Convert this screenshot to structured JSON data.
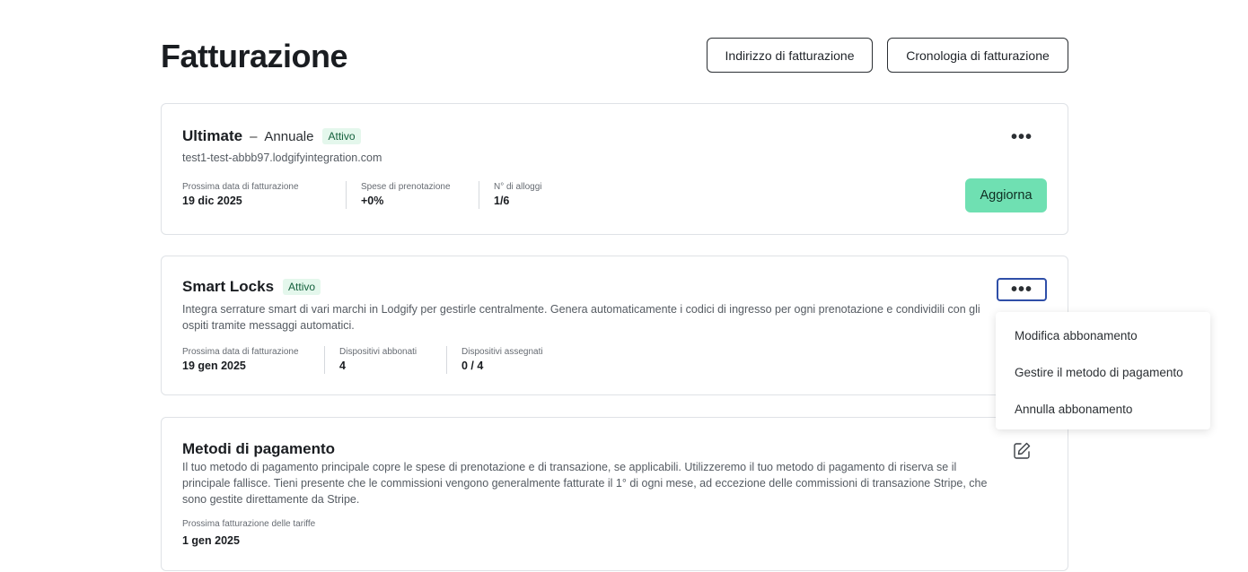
{
  "page": {
    "title": "Fatturazione"
  },
  "header": {
    "billing_address_label": "Indirizzo di fatturazione",
    "billing_history_label": "Cronologia di fatturazione"
  },
  "ultimate_plan": {
    "name": "Ultimate",
    "dash": "–",
    "period": "Annuale",
    "status": "Attivo",
    "domain": "test1-test-abbb97.lodgifyintegration.com",
    "more_label": "•••",
    "upgrade_label": "Aggiorna",
    "stats": [
      {
        "label": "Prossima data di fatturazione",
        "value": "19 dic 2025"
      },
      {
        "label": "Spese di prenotazione",
        "value": "+0%"
      },
      {
        "label": "N° di alloggi",
        "value": "1/6"
      }
    ]
  },
  "smart_locks": {
    "name": "Smart Locks",
    "status": "Attivo",
    "description": "Integra serrature smart di vari marchi in Lodgify per gestirle centralmente. Genera automaticamente i codici di ingresso per ogni prenotazione e condividili con gli ospiti tramite messaggi automatici.",
    "more_label": "•••",
    "stats": [
      {
        "label": "Prossima data di fatturazione",
        "value": "19 gen 2025"
      },
      {
        "label": "Dispositivi abbonati",
        "value": "4"
      },
      {
        "label": "Dispositivi assegnati",
        "value": "0 / 4"
      }
    ]
  },
  "payment_methods": {
    "title": "Metodi di pagamento",
    "description": "Il tuo metodo di pagamento principale copre le spese di prenotazione e di transazione, se applicabili. Utilizzeremo il tuo metodo di pagamento di riserva se il principale fallisce. Tieni presente che le commissioni vengono generalmente fatturate il 1° di ogni mese, ad eccezione delle commissioni di transazione Stripe, che sono gestite direttamente da Stripe.",
    "next_label": "Prossima fatturazione delle tariffe",
    "next_value": "1 gen 2025",
    "edit_icon": "pencil-square-icon"
  },
  "dropdown": {
    "items": [
      {
        "label": "Modifica abbonamento"
      },
      {
        "label": "Gestire il metodo di pagamento"
      },
      {
        "label": "Annulla abbonamento"
      }
    ]
  },
  "colors": {
    "upgrade_bg": "#6fe0b2",
    "badge_bg": "#e4f7ec",
    "focus_ring": "#2f4fa8"
  }
}
